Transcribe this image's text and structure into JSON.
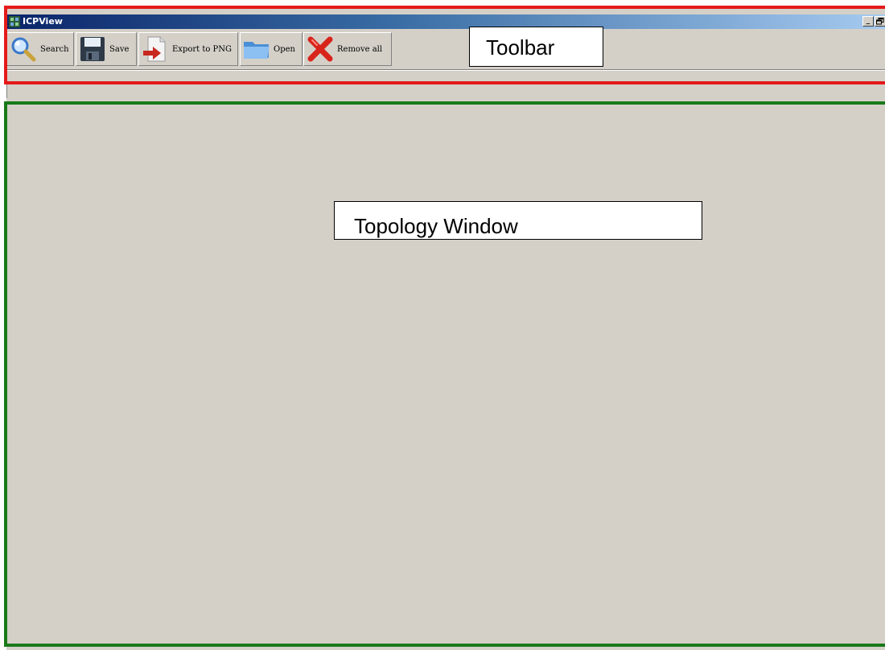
{
  "window": {
    "title": "ICPView",
    "caption_buttons": {
      "minimize": "_",
      "restore": "🗗",
      "close": "x"
    }
  },
  "toolbar": {
    "buttons": [
      {
        "label": "Search",
        "icon": "search-icon"
      },
      {
        "label": "Save",
        "icon": "floppy-disk-icon"
      },
      {
        "label": "Export to PNG",
        "icon": "export-document-icon"
      },
      {
        "label": "Open",
        "icon": "folder-icon"
      },
      {
        "label": "Remove all",
        "icon": "red-x-icon"
      }
    ]
  },
  "annotations": {
    "toolbar_label": "Toolbar",
    "topology_label": "Topology Window",
    "toolbar_color": "#e41a1a",
    "topology_color": "#1a7a1a"
  },
  "colors": {
    "window_gray": "#d4d0c8",
    "titlebar_start": "#0a246a",
    "titlebar_end": "#a6caf0"
  }
}
